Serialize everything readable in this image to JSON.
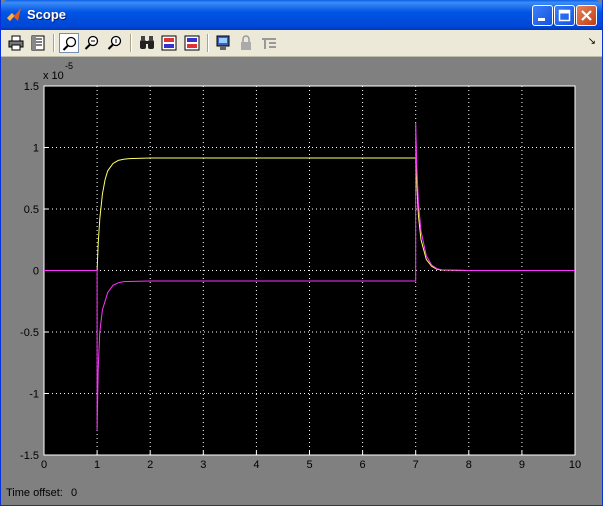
{
  "window": {
    "title": "Scope"
  },
  "toolbar": {
    "tools": [
      "print-icon",
      "parameters-icon",
      "zoom-icon",
      "zoom-x-icon",
      "zoom-y-icon",
      "autoscale-icon",
      "save-axes-icon",
      "restore-axes-icon",
      "floating-scope-icon",
      "lock-icon",
      "signal-selection-icon"
    ]
  },
  "chart_data": {
    "type": "line",
    "title": "",
    "xlabel": "",
    "ylabel": "",
    "exponent_label": "x 10",
    "exponent_power": "-5",
    "xlim": [
      0,
      10
    ],
    "ylim": [
      -1.5,
      1.5
    ],
    "y_scale_note": "values in units of 1e-5",
    "x_ticks": [
      "0",
      "1",
      "2",
      "3",
      "4",
      "5",
      "6",
      "7",
      "8",
      "9",
      "10"
    ],
    "y_ticks": [
      "1.5",
      "1",
      "0.5",
      "0",
      "-0.5",
      "-1",
      "-1.5"
    ],
    "grid": true,
    "background": "#000000",
    "series": [
      {
        "color": "#ffff66",
        "x": [
          0,
          1,
          1.02,
          1.05,
          1.1,
          1.15,
          1.2,
          1.3,
          1.4,
          1.5,
          1.6,
          2,
          4,
          6,
          7,
          7.02,
          7.05,
          7.1,
          7.2,
          7.3,
          7.4,
          7.5,
          8,
          10
        ],
        "y": [
          0,
          0,
          0.22,
          0.42,
          0.62,
          0.74,
          0.81,
          0.87,
          0.895,
          0.905,
          0.91,
          0.915,
          0.915,
          0.915,
          0.915,
          0.7,
          0.45,
          0.25,
          0.09,
          0.035,
          0.01,
          0.003,
          0,
          0
        ]
      },
      {
        "color": "#ff33ff",
        "x": [
          0,
          1,
          1.0,
          1.02,
          1.05,
          1.1,
          1.2,
          1.3,
          1.4,
          1.5,
          2,
          4,
          6,
          7,
          7.0,
          7.02,
          7.05,
          7.1,
          7.2,
          7.3,
          7.4,
          7.5,
          8,
          10
        ],
        "y": [
          0,
          0,
          -1.3,
          -0.8,
          -0.5,
          -0.32,
          -0.18,
          -0.12,
          -0.1,
          -0.09,
          -0.085,
          -0.085,
          -0.085,
          -0.085,
          1.2,
          0.85,
          0.55,
          0.32,
          0.12,
          0.045,
          0.015,
          0.005,
          0,
          0
        ]
      }
    ]
  },
  "status": {
    "offset_label": "Time offset:",
    "offset_value": "0"
  }
}
